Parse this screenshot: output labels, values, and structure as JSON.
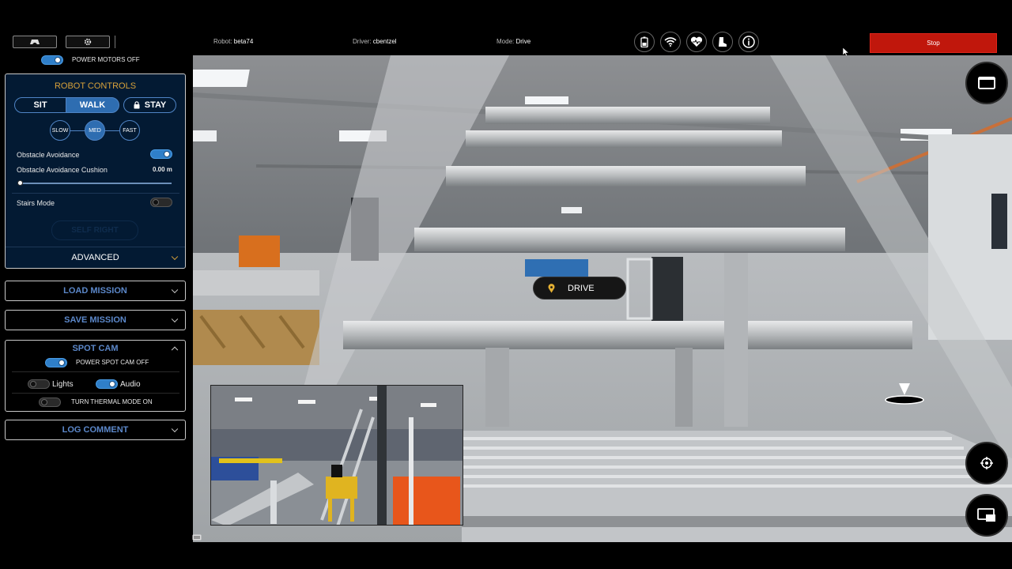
{
  "header": {
    "robot_label": "Robot: ",
    "robot_value": "beta74",
    "driver_label": "Driver: ",
    "driver_value": "cbentzel",
    "mode_label": "Mode: ",
    "mode_value": "Drive",
    "stop_label": "Stop",
    "status_icons": [
      "battery-icon",
      "wifi-icon",
      "health-heart-icon",
      "boot-icon",
      "info-icon"
    ],
    "left_buttons": [
      "gamepad-icon",
      "gear-icon"
    ]
  },
  "power_motors": {
    "label": "POWER MOTORS OFF",
    "on": true
  },
  "robot_controls": {
    "title": "ROBOT CONTROLS",
    "modes": [
      "SIT",
      "WALK",
      "STAY"
    ],
    "selected_mode": "WALK",
    "speeds": [
      "SLOW",
      "MED",
      "FAST"
    ],
    "selected_speed": "MED",
    "obstacle_avoidance_label": "Obstacle Avoidance",
    "obstacle_avoidance_on": true,
    "cushion_label": "Obstacle Avoidance Cushion",
    "cushion_value": "0.00 m",
    "stairs_mode_label": "Stairs Mode",
    "stairs_mode_on": false,
    "self_right_label": "SELF RIGHT",
    "advanced_label": "ADVANCED"
  },
  "load_mission_label": "LOAD MISSION",
  "save_mission_label": "SAVE MISSION",
  "spot_cam": {
    "title": "SPOT CAM",
    "power_label": "POWER SPOT CAM OFF",
    "power_on": true,
    "lights_label": "Lights",
    "lights_on": false,
    "audio_label": "Audio",
    "audio_on": true,
    "thermal_label": "TURN THERMAL MODE ON",
    "thermal_on": false
  },
  "log_comment_label": "LOG COMMENT",
  "camera": {
    "drive_label": "DRIVE"
  },
  "colors": {
    "accent": "#2f7fc9",
    "panel_bg": "#031a33",
    "title_gold": "#d7a13a",
    "stop_red": "#c0170c"
  }
}
